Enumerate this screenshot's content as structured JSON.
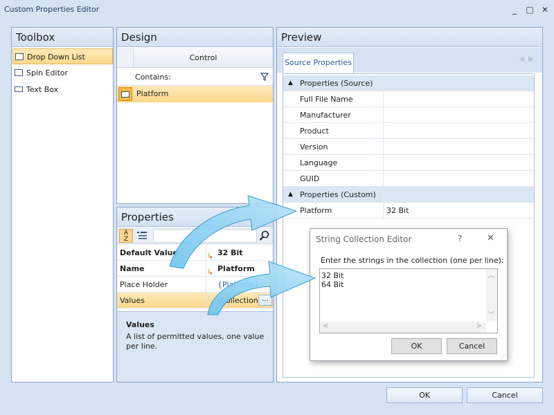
{
  "window": {
    "title": "Custom Properties Editor",
    "min": "_",
    "max": "□",
    "close": "✕"
  },
  "toolbox": {
    "header": "Toolbox",
    "items": [
      {
        "label": "Drop Down List"
      },
      {
        "label": "Spin Editor"
      },
      {
        "label": "Text Box"
      }
    ]
  },
  "design": {
    "header": "Design",
    "column": "Control",
    "filter_label": "Contains:",
    "row": "Platform"
  },
  "properties": {
    "header": "Properties",
    "rows": [
      {
        "name": "Default Value",
        "value": "32 Bit"
      },
      {
        "name": "Name",
        "value": "Platform"
      },
      {
        "name": "Place Holder",
        "value": "{Platform}"
      },
      {
        "name": "Values",
        "value": "(Collection)",
        "ellipsis": "..."
      }
    ],
    "desc_title": "Values",
    "desc_text": "A list of permitted values, one value per line."
  },
  "preview": {
    "header": "Preview",
    "tab": "Source Properties",
    "group_source": "Properties (Source)",
    "source_rows": [
      "Full File Name",
      "Manufacturer",
      "Product",
      "Version",
      "Language",
      "GUID"
    ],
    "group_custom": "Properties (Custom)",
    "custom_row": {
      "name": "Platform",
      "value": "32 Bit"
    }
  },
  "dialog": {
    "title": "String Collection Editor",
    "help": "?",
    "close": "✕",
    "prompt": "Enter the strings in the collection (one per line):",
    "lines": [
      "32 Bit",
      "64 Bit"
    ],
    "ok": "OK",
    "cancel": "Cancel"
  },
  "footer": {
    "ok": "OK",
    "cancel": "Cancel"
  }
}
